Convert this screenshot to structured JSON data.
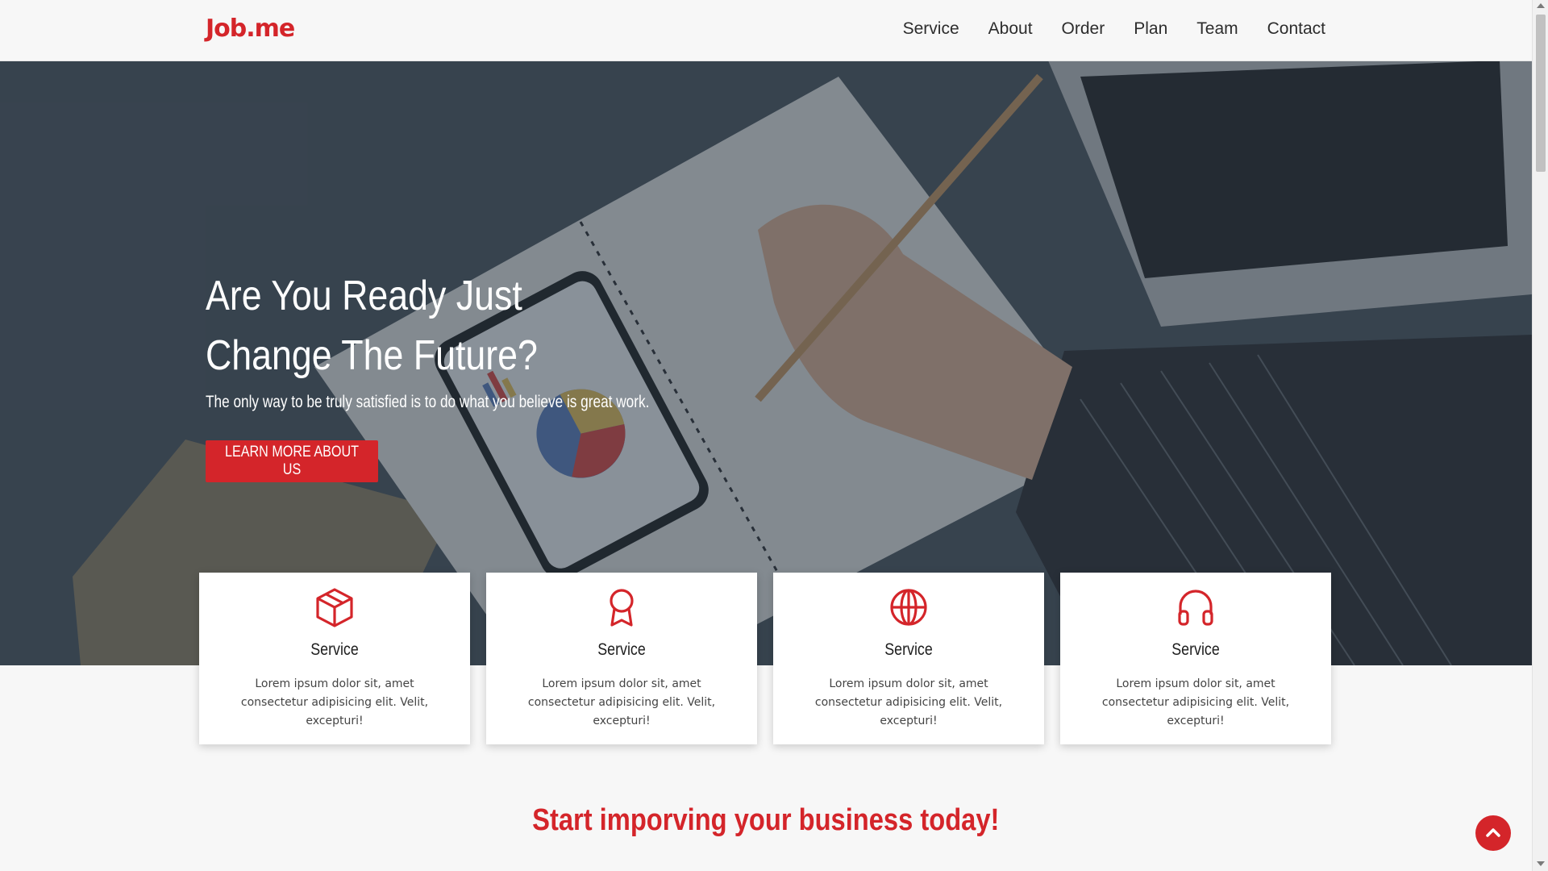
{
  "header": {
    "logo": "Job.me",
    "nav": [
      "Service",
      "About",
      "Order",
      "Plan",
      "Team",
      "Contact"
    ]
  },
  "hero": {
    "title": "Are You Ready Just Change The Future?",
    "subtitle": "The only way to be truly satisfied is to do what you believe is great work.",
    "button_label": "LEARN MORE ABOUT US"
  },
  "services": [
    {
      "icon": "box-icon",
      "title": "Service",
      "text": "Lorem ipsum dolor sit, amet consectetur adipisicing elit. Velit, excepturi!"
    },
    {
      "icon": "award-icon",
      "title": "Service",
      "text": "Lorem ipsum dolor sit, amet consectetur adipisicing elit. Velit, excepturi!"
    },
    {
      "icon": "globe-icon",
      "title": "Service",
      "text": "Lorem ipsum dolor sit, amet consectetur adipisicing elit. Velit, excepturi!"
    },
    {
      "icon": "headphones-icon",
      "title": "Service",
      "text": "Lorem ipsum dolor sit, amet consectetur adipisicing elit. Velit, excepturi!"
    }
  ],
  "cta": {
    "title": "Start imporving your business today!"
  },
  "scroll_top": {
    "icon": "chevron-up-icon"
  },
  "colors": {
    "accent": "#d4252a",
    "hero_overlay": "#3a4652",
    "background": "#f7f7f7"
  }
}
